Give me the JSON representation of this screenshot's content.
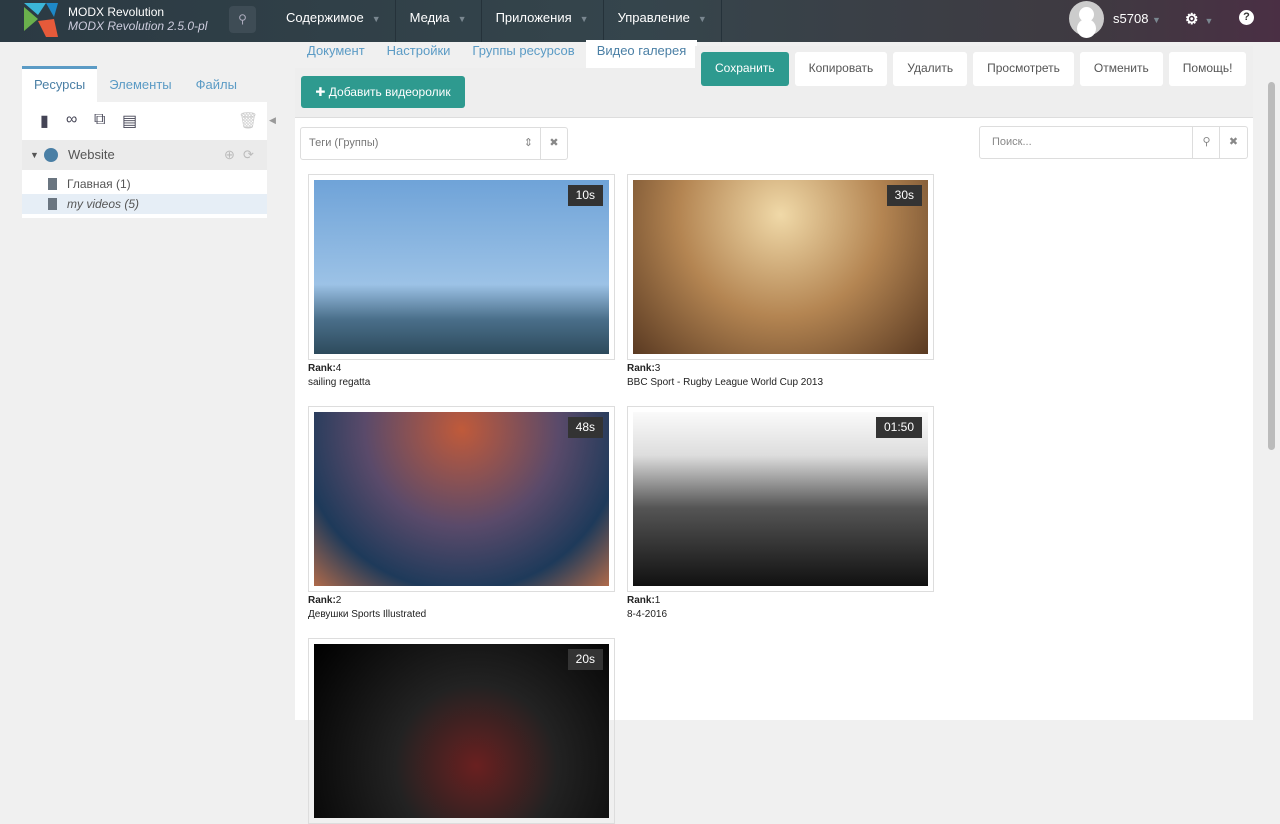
{
  "header": {
    "brand_title": "MODX Revolution",
    "brand_version": "MODX Revolution 2.5.0-pl",
    "nav": [
      "Содержимое",
      "Медиа",
      "Приложения",
      "Управление"
    ],
    "user": "s5708"
  },
  "left": {
    "tabs": [
      "Ресурсы",
      "Элементы",
      "Файлы"
    ],
    "context": "Website",
    "tree": [
      "Главная (1)",
      "my videos (5)"
    ]
  },
  "resource_tabs": [
    "Документ",
    "Настройки",
    "Группы ресурсов",
    "Видео галерея"
  ],
  "actions": [
    "Сохранить",
    "Копировать",
    "Удалить",
    "Просмотреть",
    "Отменить",
    "Помощь!"
  ],
  "gallery": {
    "add_button": "Добавить видеоролик",
    "tags_placeholder": "Теги (Группы)",
    "search_placeholder": "Поиск...",
    "rank_label": "Rank:",
    "videos": [
      {
        "duration": "10s",
        "rank": "4",
        "title": "sailing regatta"
      },
      {
        "duration": "30s",
        "rank": "3",
        "title": "BBC Sport - Rugby League World Cup 2013"
      },
      {
        "duration": "48s",
        "rank": "2",
        "title": "Девушки Sports Illustrated"
      },
      {
        "duration": "01:50",
        "rank": "1",
        "title": "8-4-2016"
      },
      {
        "duration": "20s"
      }
    ]
  },
  "colors": {
    "accent": "#2e9a8f",
    "link": "#5b9bc5"
  }
}
